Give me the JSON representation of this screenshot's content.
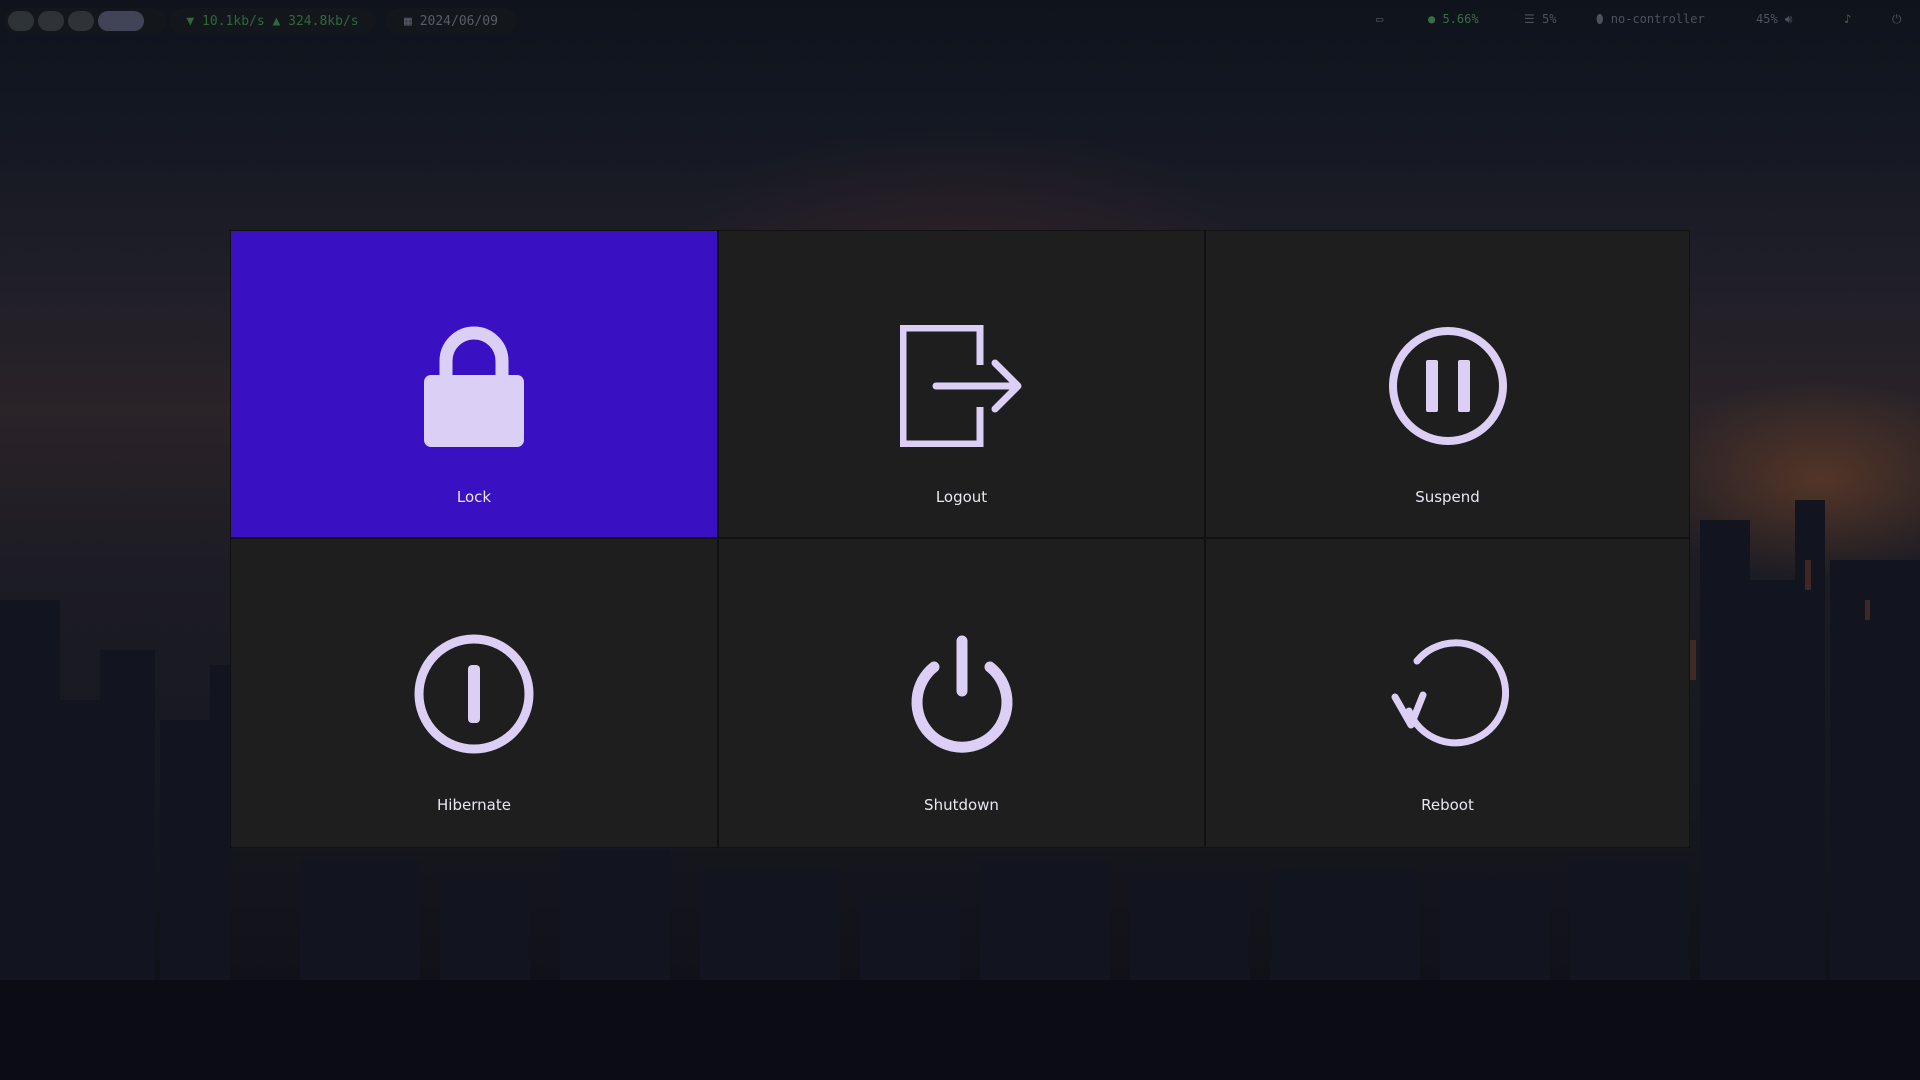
{
  "topbar": {
    "network": "▼ 10.1kb/s ▲ 324.8kb/s",
    "date": "2024/06/09",
    "cpu": "5.66%",
    "memory": "5%",
    "controller": "no-controller",
    "volume": "45%"
  },
  "actions": [
    {
      "id": "lock",
      "label": "Lock",
      "icon": "lock-icon",
      "selected": true
    },
    {
      "id": "logout",
      "label": "Logout",
      "icon": "logout-icon"
    },
    {
      "id": "suspend",
      "label": "Suspend",
      "icon": "pause-circle-icon"
    },
    {
      "id": "hibernate",
      "label": "Hibernate",
      "icon": "hibernate-icon"
    },
    {
      "id": "shutdown",
      "label": "Shutdown",
      "icon": "power-icon"
    },
    {
      "id": "reboot",
      "label": "Reboot",
      "icon": "reboot-icon"
    }
  ],
  "colors": {
    "selected_tile": "#3910c2",
    "tile": "#1e1e1e",
    "icon": "#dccff5",
    "label": "#e8e6f0"
  }
}
